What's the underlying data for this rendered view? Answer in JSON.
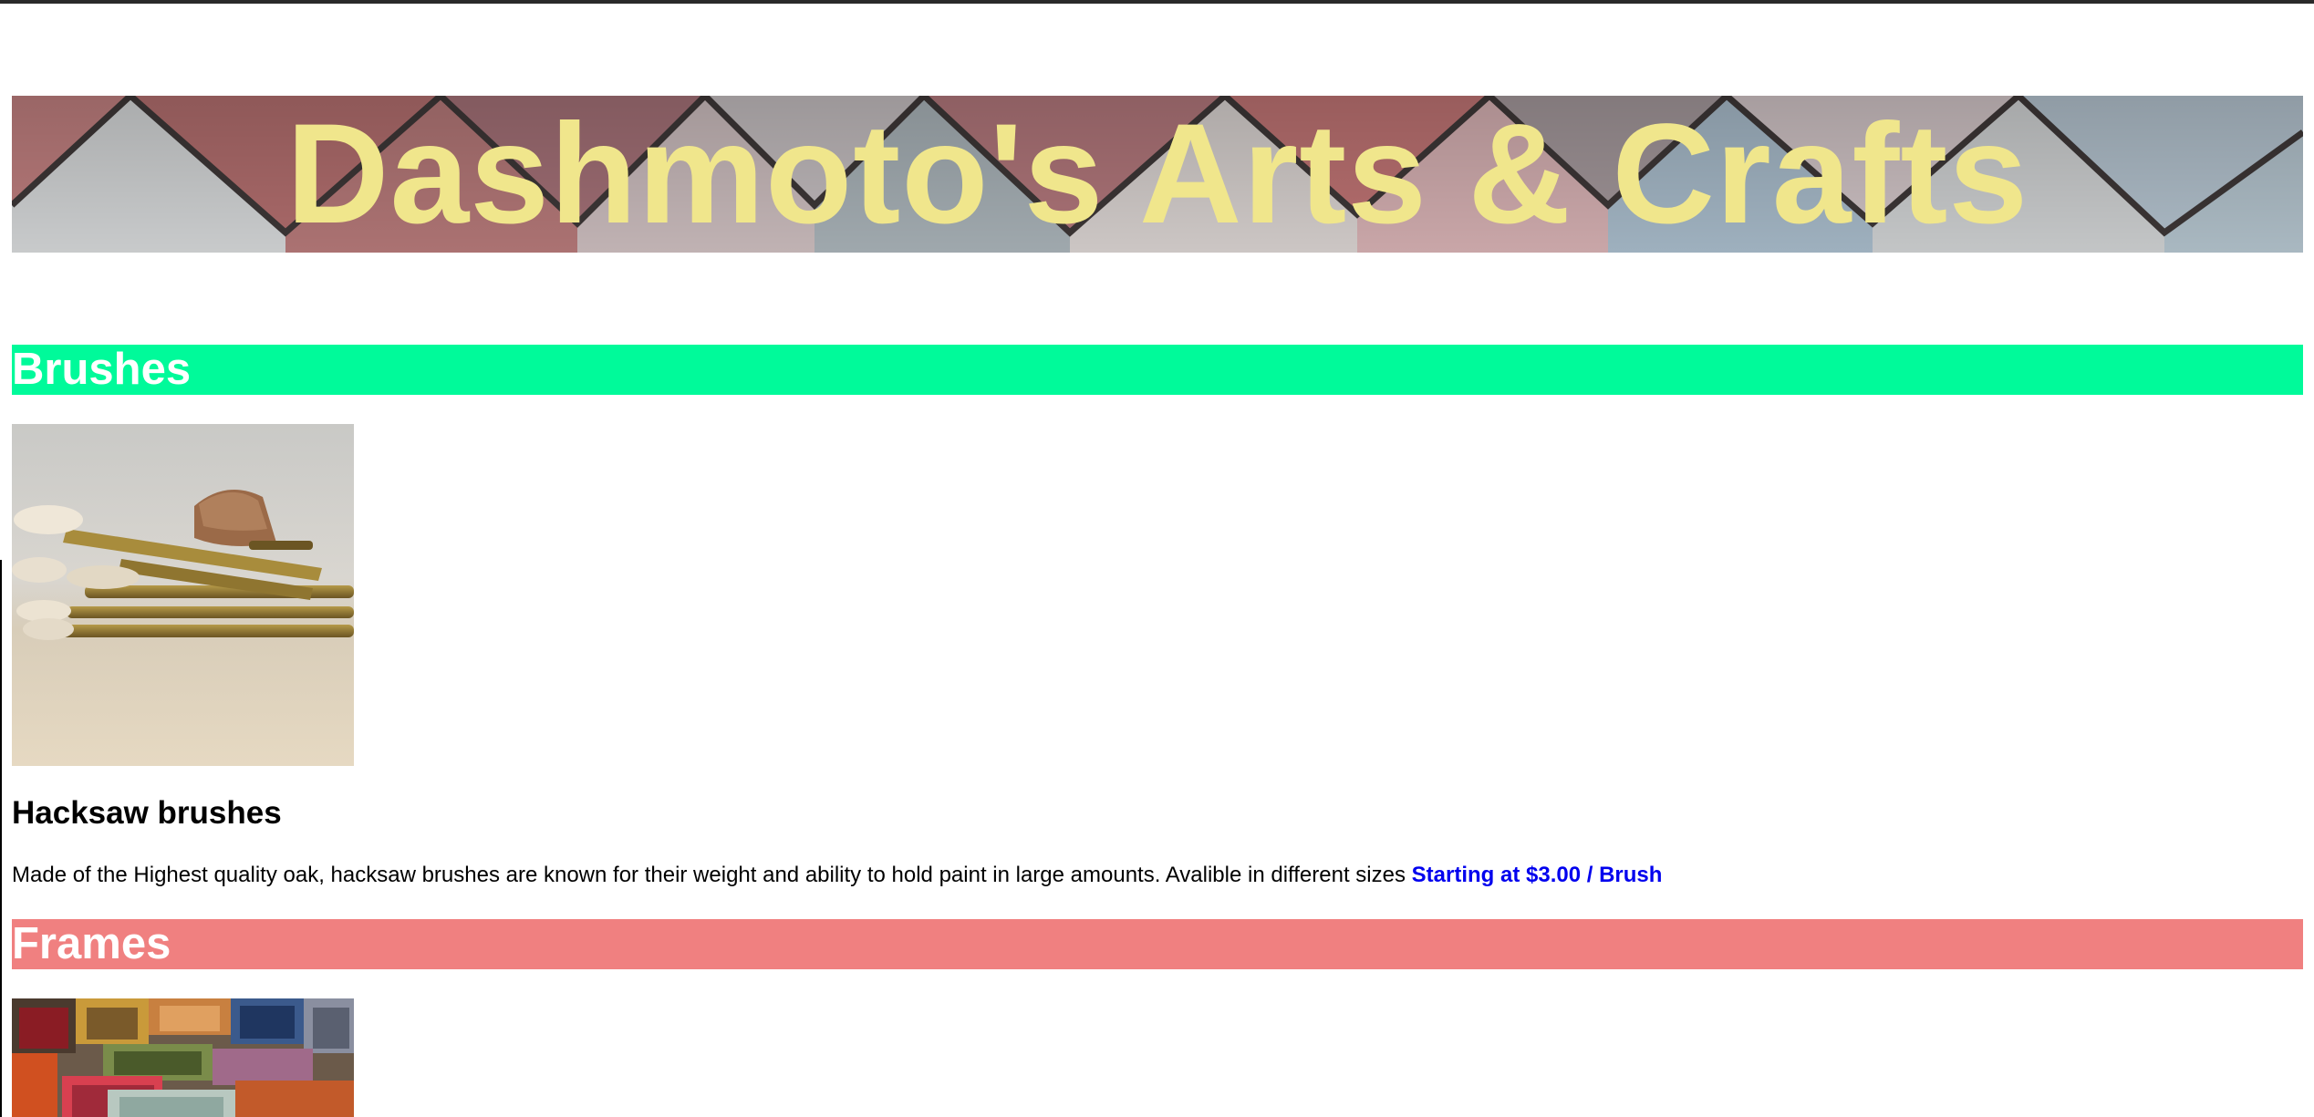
{
  "site": {
    "title": "Dashmoto's Arts & Crafts"
  },
  "sections": [
    {
      "heading": "Brushes",
      "product": {
        "name": "Hacksaw brushes",
        "description": "Made of the Highest quality oak, hacksaw brushes are known for their weight and ability to hold paint in large amounts. Avalible in different sizes",
        "price": "Starting at $3.00 / Brush"
      }
    },
    {
      "heading": "Frames"
    }
  ],
  "colors": {
    "title_text": "#f0e68c",
    "brushes_header_bg": "#00fa9a",
    "frames_header_bg": "#f08080",
    "price_text": "#0000ee"
  }
}
